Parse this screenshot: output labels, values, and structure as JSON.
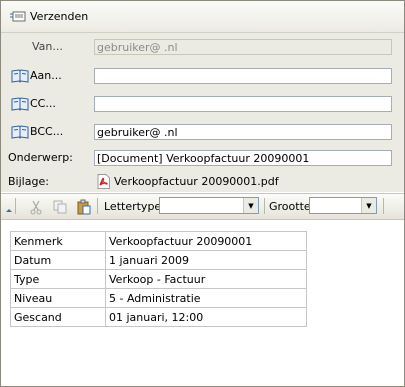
{
  "toolbar": {
    "send_label": "Verzenden"
  },
  "header": {
    "from": {
      "label": "Van...",
      "value": "gebruiker@        .nl"
    },
    "to": {
      "label": "Aan...",
      "value": ""
    },
    "cc": {
      "label": "CC...",
      "value": ""
    },
    "bcc": {
      "label": "BCC...",
      "value": "gebruiker@       .nl"
    },
    "subject": {
      "label": "Onderwerp:",
      "value": "[Document] Verkoopfactuur 20090001"
    },
    "attachment": {
      "label": "Bijlage:",
      "file": "Verkoopfactuur 20090001.pdf"
    }
  },
  "editor_toolbar": {
    "font_label": "Lettertype",
    "font_value": "",
    "size_label": "Grootte",
    "size_value": "",
    "icons": [
      "cut-icon",
      "copy-icon",
      "paste-icon"
    ]
  },
  "table": {
    "rows": [
      [
        "Kenmerk",
        "Verkoopfactuur 20090001"
      ],
      [
        "Datum",
        "1 januari 2009"
      ],
      [
        "Type",
        "Verkoop - Factuur"
      ],
      [
        "Niveau",
        "5 - Administratie"
      ],
      [
        "Gescand",
        "01 januari, 12:00"
      ]
    ]
  }
}
